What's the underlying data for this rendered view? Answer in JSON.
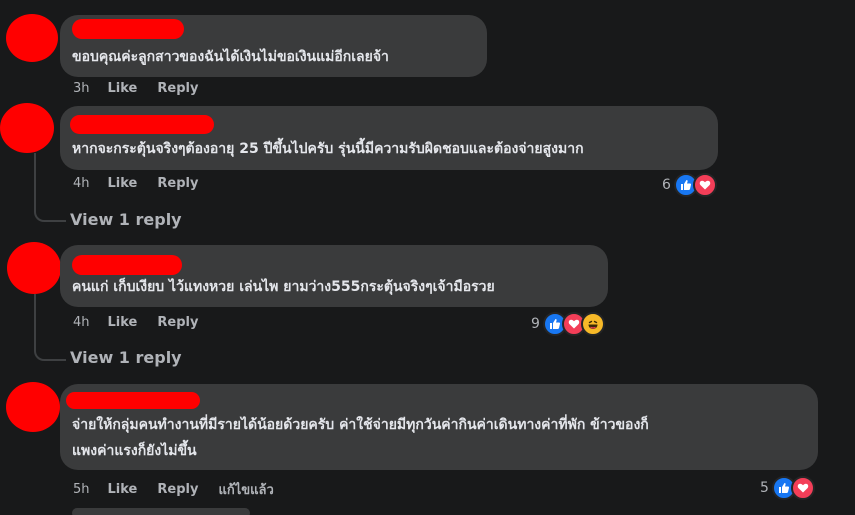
{
  "comments": [
    {
      "text_lines": [
        "ขอบคุณค่ะลูกสาวของฉันได้เงินไม่ขอเงินแม่อีกเลยจ้า"
      ],
      "time": "3h",
      "like_label": "Like",
      "reply_label": "Reply"
    },
    {
      "text_lines": [
        "หากจะกระตุ้นจริงๆต้องอายุ 25 ปีขึ้นไปครับ รุ่นนี้มีความรับผิดชอบและต้องจ่ายสูงมาก"
      ],
      "time": "4h",
      "like_label": "Like",
      "reply_label": "Reply",
      "reaction_count": "6",
      "reactions": [
        "like",
        "love"
      ],
      "view_replies_label": "View 1 reply"
    },
    {
      "text_lines": [
        "คนแก่ เก็บเงียบ ไว้แทงหวย เล่นไพ ยามว่าง555กระตุ้นจริงๆเจ้ามือรวย"
      ],
      "time": "4h",
      "like_label": "Like",
      "reply_label": "Reply",
      "reaction_count": "9",
      "reactions": [
        "like",
        "love",
        "haha"
      ],
      "view_replies_label": "View 1 reply"
    },
    {
      "text_lines": [
        "จ่ายให้กลุ่มคนทำงานที่มีรายได้น้อยด้วยครับ ค่าใช้จ่ายมีทุกวันค่ากินค่าเดินทางค่าที่พัก ข้าวของก็",
        "แพงค่าแรงก็ยังไม่ขึ้น"
      ],
      "time": "5h",
      "like_label": "Like",
      "reply_label": "Reply",
      "edited_label": "แก้ไขแล้ว",
      "reaction_count": "5",
      "reactions": [
        "like",
        "love"
      ]
    }
  ],
  "colors": {
    "background": "#18191a",
    "bubble": "#3a3b3c",
    "text": "#e4e6eb",
    "secondary_text": "#b0b3b8",
    "redaction": "#ff0000",
    "like_blue": "#1877f2",
    "love_red": "#f33e58",
    "haha_yellow": "#f7b928"
  }
}
